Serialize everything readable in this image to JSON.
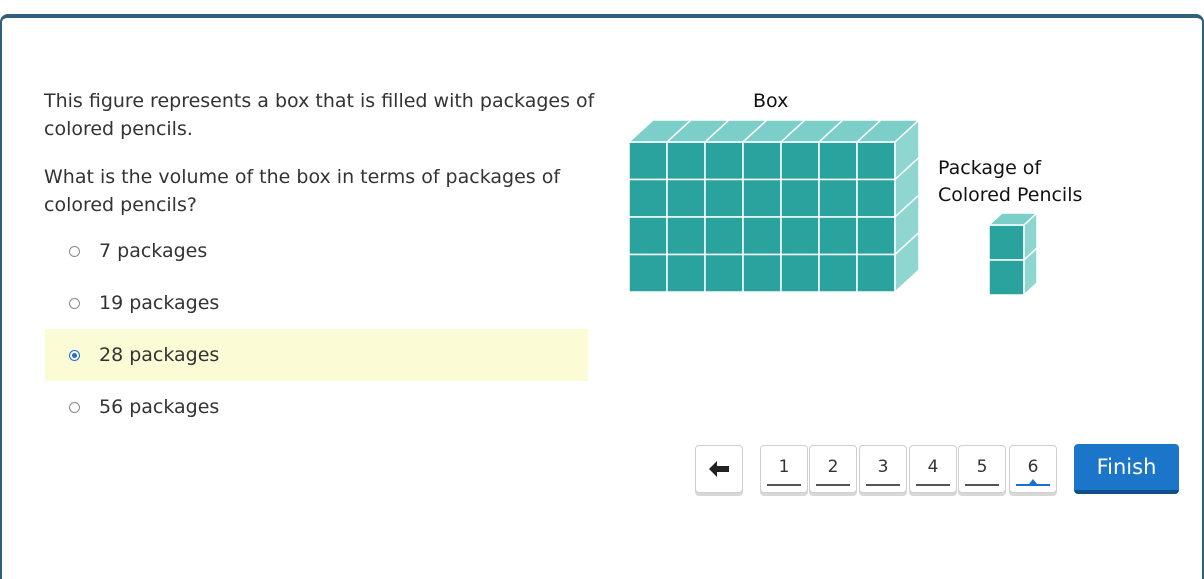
{
  "question": {
    "paragraph1": "This figure represents a box that is filled with packages of colored pencils.",
    "paragraph2": "What is the volume of the box in terms of packages of colored pencils?"
  },
  "choices": [
    {
      "label": "7 packages",
      "selected": false
    },
    {
      "label": "19 packages",
      "selected": false
    },
    {
      "label": "28 packages",
      "selected": true
    },
    {
      "label": "56 packages",
      "selected": false
    }
  ],
  "figure": {
    "box_label": "Box",
    "package_label_line1": "Package of",
    "package_label_line2": "Colored Pencils",
    "colors": {
      "front": "#2aa29d",
      "top": "#7ccfc9",
      "side": "#8fd6d1",
      "grid": "#ffffff"
    }
  },
  "navigation": {
    "back_icon": "arrow-left-icon",
    "pages": [
      "1",
      "2",
      "3",
      "4",
      "5",
      "6"
    ],
    "current_page": "6",
    "finish_label": "Finish"
  },
  "colors": {
    "accent": "#1b75c9",
    "selected_bg": "#fbfbd5",
    "frame": "#2e5f7f"
  }
}
